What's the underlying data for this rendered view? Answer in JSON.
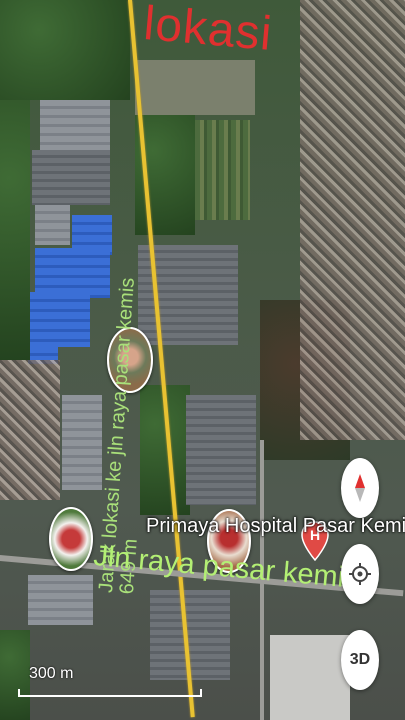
{
  "map": {
    "annotations": {
      "site_label": "lokasi",
      "distance_line1": "Jarak lokasi ke jln raya pasar kemis",
      "distance_line2": "649 m",
      "road_label": "Jln raya pasar kemis"
    },
    "poi": {
      "name": "Primaya Hospital Pasar Kemis",
      "icon": "hospital-marker-icon",
      "marker_letter": "H",
      "marker_color": "#e04a45"
    },
    "controls": {
      "compass_icon": "compass-icon",
      "locate_icon": "my-location-icon",
      "view_3d_label": "3D"
    },
    "scale_bar": {
      "label": "300 m"
    },
    "colors": {
      "site_label": "#e0302f",
      "annotation_text": "#a9e07a",
      "road_line": "#e8c232"
    }
  }
}
